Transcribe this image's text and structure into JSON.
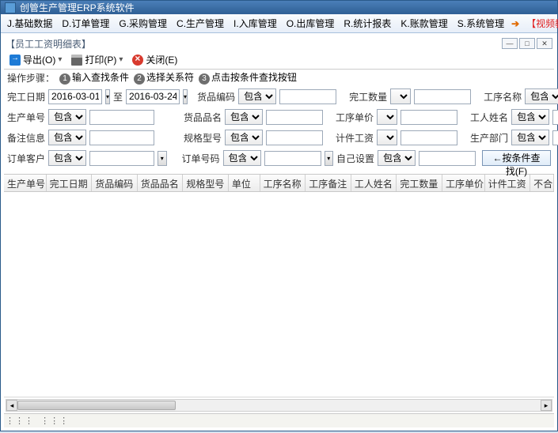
{
  "window": {
    "title": "创管生产管理ERP系统软件"
  },
  "menu": {
    "items": [
      "J.基础数据",
      "D.订单管理",
      "G.采购管理",
      "C.生产管理",
      "I.入库管理",
      "O.出库管理",
      "R.统计报表",
      "K.账款管理",
      "S.系统管理"
    ],
    "video": "【视频教程，先看再用】"
  },
  "panel": {
    "title": "【员工工资明细表】"
  },
  "toolbar": {
    "export": "导出(O)",
    "print": "打印(P)",
    "close": "关闭(E)"
  },
  "steps": {
    "label": "操作步骤：",
    "s1": "输入查找条件",
    "s2": "选择关系符",
    "s3": "点击按条件查找按钮"
  },
  "filters": {
    "row1": {
      "f1_label": "完工日期",
      "f1_from": "2016-03-01",
      "f1_to_label": "至",
      "f1_to": "2016-03-24",
      "f2_label": "货品编码",
      "f2_op": "包含",
      "f2_val": "",
      "f3_label": "完工数量",
      "f3_op": "",
      "f3_val": "",
      "f4_label": "工序名称",
      "f4_op": "包含",
      "f4_val": ""
    },
    "row2": {
      "f1_label": "生产单号",
      "f1_op": "包含",
      "f1_val": "",
      "f2_label": "货品品名",
      "f2_op": "包含",
      "f2_val": "",
      "f3_label": "工序单价",
      "f3_op": "",
      "f3_val": "",
      "f4_label": "工人姓名",
      "f4_op": "包含",
      "f4_val": ""
    },
    "row3": {
      "f1_label": "备注信息",
      "f1_op": "包含",
      "f1_val": "",
      "f2_label": "规格型号",
      "f2_op": "包含",
      "f2_val": "",
      "f3_label": "计件工资",
      "f3_op": "",
      "f3_val": "",
      "f4_label": "生产部门",
      "f4_op": "包含",
      "f4_val": ""
    },
    "row4": {
      "f1_label": "订单客户",
      "f1_op": "包含",
      "f1_val": "",
      "f2_label": "订单号码",
      "f2_op": "包含",
      "f2_val": "",
      "f3_label": "自己设置",
      "f3_op": "包含",
      "f3_val": "",
      "search": "←按条件查找(F)"
    }
  },
  "grid": {
    "columns": [
      "生产单号",
      "完工日期",
      "货品编码",
      "货品品名",
      "规格型号",
      "单位",
      "工序名称",
      "工序备注",
      "工人姓名",
      "完工数量",
      "工序单价",
      "计件工资",
      "不合"
    ]
  }
}
